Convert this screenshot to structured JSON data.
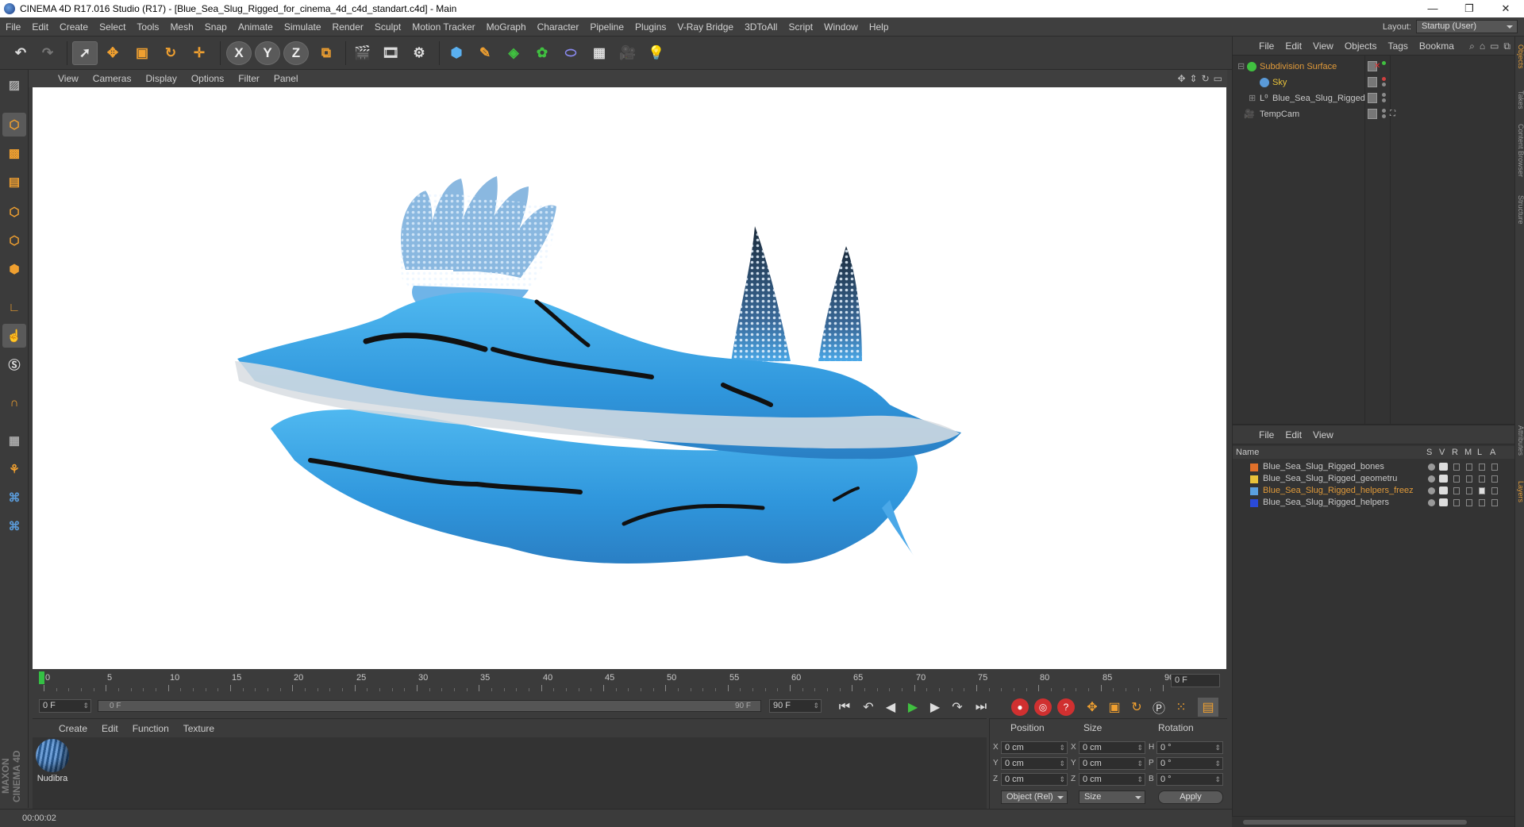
{
  "window": {
    "title": "CINEMA 4D R17.016 Studio (R17) - [Blue_Sea_Slug_Rigged_for_cinema_4d_c4d_standart.c4d] - Main",
    "controls": [
      "—",
      "❐",
      "✕"
    ]
  },
  "menubar": {
    "items": [
      "File",
      "Edit",
      "Create",
      "Select",
      "Tools",
      "Mesh",
      "Snap",
      "Animate",
      "Simulate",
      "Render",
      "Sculpt",
      "Motion Tracker",
      "MoGraph",
      "Character",
      "Pipeline",
      "Plugins",
      "V-Ray Bridge",
      "3DToAll",
      "Script",
      "Window",
      "Help"
    ],
    "layout_label": "Layout:",
    "layout_value": "Startup (User)"
  },
  "toolbar": {
    "icons": [
      "undo-icon",
      "redo-icon",
      "select-icon",
      "move-icon",
      "scale-icon",
      "rotate-icon",
      "live-select-icon",
      "x-axis-icon",
      "y-axis-icon",
      "z-axis-icon",
      "coordinate-system-icon",
      "render-view-icon",
      "render-picture-viewer-icon",
      "render-settings-icon",
      "cube-icon",
      "pen-spline-icon",
      "subdivision-icon",
      "cloner-icon",
      "deformer-icon",
      "floor-icon",
      "camera-icon",
      "light-icon"
    ],
    "axis_labels": [
      "X",
      "Y",
      "Z"
    ]
  },
  "viewport": {
    "menu": [
      "View",
      "Cameras",
      "Display",
      "Options",
      "Filter",
      "Panel"
    ]
  },
  "timeline": {
    "ticks": [
      "0",
      "5",
      "10",
      "15",
      "20",
      "25",
      "30",
      "35",
      "40",
      "45",
      "50",
      "55",
      "60",
      "65",
      "70",
      "75",
      "80",
      "85",
      "90"
    ],
    "end_frame": "0 F",
    "current_frame": "0 F",
    "range_start": "0 F",
    "range_end": "90 F",
    "max_frame": "90 F"
  },
  "materials": {
    "menu": [
      "Create",
      "Edit",
      "Function",
      "Texture"
    ],
    "items": [
      {
        "name": "Nudibra"
      }
    ]
  },
  "coordinates": {
    "headers": [
      "Position",
      "Size",
      "Rotation"
    ],
    "rows": [
      {
        "axis": "X",
        "pos": "0 cm",
        "size_axis": "X",
        "size": "0 cm",
        "rot_axis": "H",
        "rot": "0 °"
      },
      {
        "axis": "Y",
        "pos": "0 cm",
        "size_axis": "Y",
        "size": "0 cm",
        "rot_axis": "P",
        "rot": "0 °"
      },
      {
        "axis": "Z",
        "pos": "0 cm",
        "size_axis": "Z",
        "size": "0 cm",
        "rot_axis": "B",
        "rot": "0 °"
      }
    ],
    "mode": "Object (Rel)",
    "size_mode": "Size",
    "apply": "Apply"
  },
  "status": {
    "time": "00:00:02"
  },
  "object_manager": {
    "menu": [
      "File",
      "Edit",
      "View",
      "Objects",
      "Tags",
      "Bookma"
    ],
    "objects": [
      {
        "name": "Subdivision Surface",
        "color": "#e09a3a"
      },
      {
        "name": "Sky",
        "color": "#e8c23a"
      },
      {
        "name": "Blue_Sea_Slug_Rigged",
        "color": "#c8c8c8"
      },
      {
        "name": "TempCam",
        "color": "#c8c8c8"
      }
    ]
  },
  "layer_manager": {
    "menu": [
      "File",
      "Edit",
      "View"
    ],
    "columns": [
      "Name",
      "S",
      "V",
      "R",
      "M",
      "L",
      "A"
    ],
    "layers": [
      {
        "name": "Blue_Sea_Slug_Rigged_bones",
        "swatch": "#e0702a",
        "color": "#c8c8c8"
      },
      {
        "name": "Blue_Sea_Slug_Rigged_geometru",
        "swatch": "#e8c23a",
        "color": "#c8c8c8"
      },
      {
        "name": "Blue_Sea_Slug_Rigged_helpers_freez",
        "swatch": "#5aa0e0",
        "color": "#e09a3a"
      },
      {
        "name": "Blue_Sea_Slug_Rigged_helpers",
        "swatch": "#2a4ad8",
        "color": "#c8c8c8"
      }
    ]
  },
  "side_tabs": [
    "Objects",
    "Takes",
    "Content Browser",
    "Structure",
    "Attributes",
    "Layers"
  ]
}
